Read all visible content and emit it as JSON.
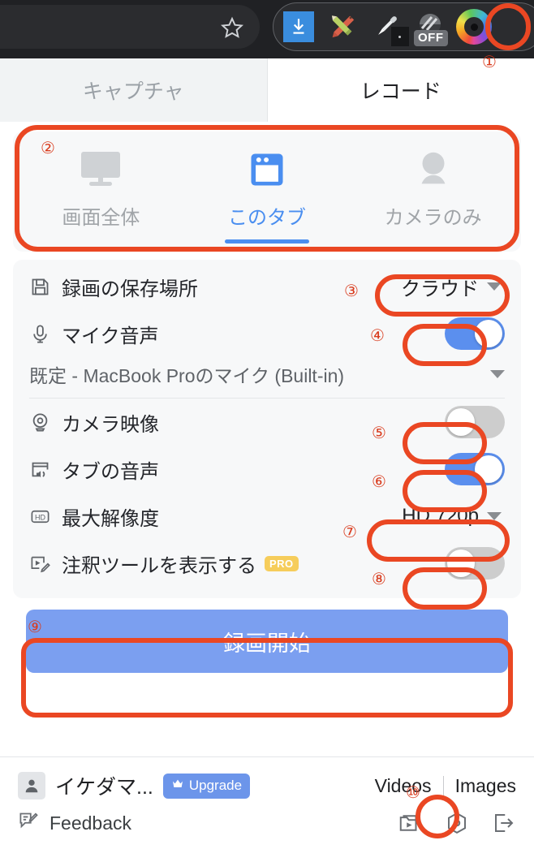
{
  "browser": {
    "icons": [
      {
        "name": "bookmark-star-icon",
        "glyph": "star"
      },
      {
        "name": "download-extension-icon",
        "glyph": "download"
      },
      {
        "name": "markup-tools-extension-icon",
        "glyph": "pencil-ruler"
      },
      {
        "name": "eyedropper-extension-icon",
        "glyph": "eyedropper"
      },
      {
        "name": "dark-reader-extension-icon",
        "glyph": "toggle-off",
        "badge": "OFF"
      },
      {
        "name": "screenity-extension-icon",
        "glyph": "camera-ring"
      }
    ]
  },
  "tabs": [
    {
      "label": "キャプチャ",
      "active": false
    },
    {
      "label": "レコード",
      "active": true
    }
  ],
  "source_selector": {
    "options": [
      {
        "label": "画面全体",
        "icon": "monitor-icon",
        "selected": false
      },
      {
        "label": "このタブ",
        "icon": "browser-tab-icon",
        "selected": true
      },
      {
        "label": "カメラのみ",
        "icon": "webcam-icon",
        "selected": false
      }
    ]
  },
  "settings": {
    "save_location": {
      "icon": "save-disk-icon",
      "label": "録画の保存場所",
      "value": "クラウド",
      "control": "dropdown"
    },
    "microphone": {
      "icon": "microphone-icon",
      "label": "マイク音声",
      "control": "toggle",
      "state": "on"
    },
    "microphone_device": {
      "value": "既定 - MacBook Proのマイク (Built-in)",
      "control": "dropdown"
    },
    "camera": {
      "icon": "webcam-icon",
      "label": "カメラ映像",
      "control": "toggle",
      "state": "off"
    },
    "tab_audio": {
      "icon": "tab-audio-icon",
      "label": "タブの音声",
      "control": "toggle",
      "state": "on"
    },
    "resolution": {
      "icon": "hd-badge-icon",
      "label": "最大解像度",
      "value": "HD 720p",
      "control": "dropdown"
    },
    "annotation_tools": {
      "icon": "annotation-pen-icon",
      "label": "注釈ツールを表示する",
      "badge": "PRO",
      "control": "toggle",
      "state": "off"
    }
  },
  "record_button": {
    "label": "録画開始"
  },
  "footer": {
    "user": {
      "name": "イケダマ...",
      "avatar_icon": "person-avatar-icon"
    },
    "upgrade": {
      "label": "Upgrade",
      "icon": "crown-icon"
    },
    "links": [
      {
        "label": "Videos"
      },
      {
        "label": "Images"
      }
    ],
    "feedback": {
      "label": "Feedback",
      "icon": "feedback-icon"
    },
    "icons": [
      {
        "name": "video-library-icon"
      },
      {
        "name": "settings-hexagon-icon"
      },
      {
        "name": "logout-icon"
      }
    ]
  },
  "annotations": [
    {
      "number": "①",
      "target": "screenity-extension-icon"
    },
    {
      "number": "②",
      "target": "source-selector"
    },
    {
      "number": "③",
      "target": "save-location-dropdown"
    },
    {
      "number": "④",
      "target": "microphone-toggle"
    },
    {
      "number": "⑤",
      "target": "camera-toggle"
    },
    {
      "number": "⑥",
      "target": "tab-audio-toggle"
    },
    {
      "number": "⑦",
      "target": "resolution-dropdown"
    },
    {
      "number": "⑧",
      "target": "annotation-tools-toggle"
    },
    {
      "number": "⑨",
      "target": "record-button"
    },
    {
      "number": "⑩",
      "target": "settings-hexagon-icon"
    }
  ],
  "colors": {
    "accent_blue": "#4a8ef0",
    "toggle_on": "#5b8fee",
    "toggle_off": "#cdcdcd",
    "record_button": "#7b9ff0",
    "annotation_red": "#ea4723",
    "pro_badge": "#f6cd5b",
    "upgrade_blue": "#6c95ea"
  }
}
